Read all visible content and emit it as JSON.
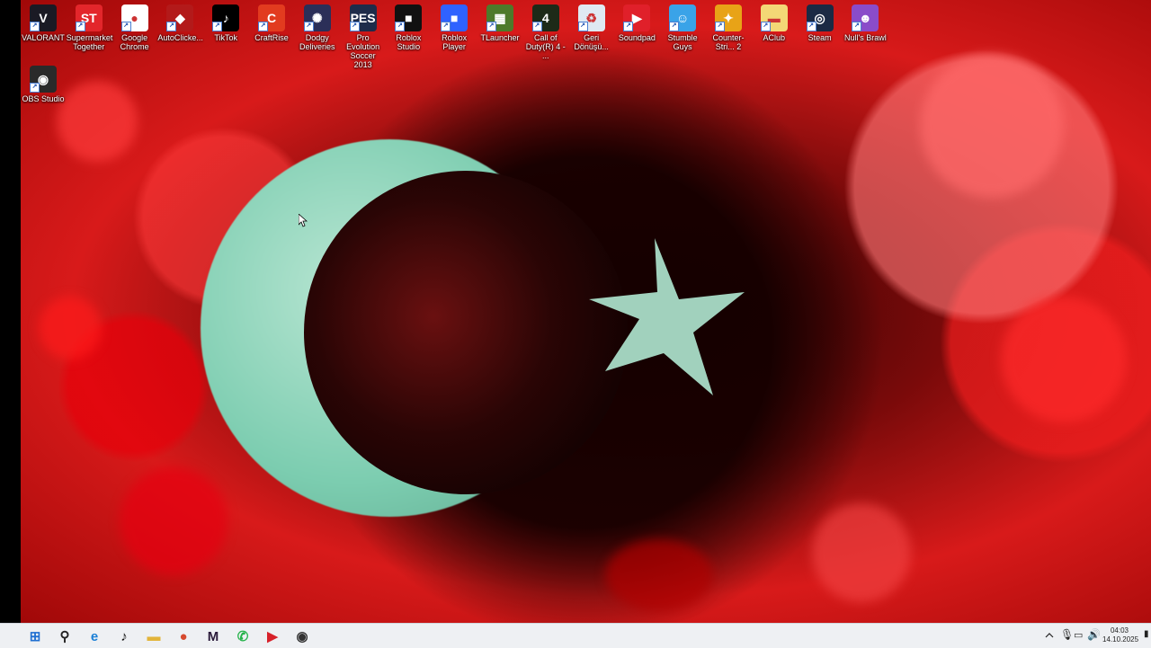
{
  "desktop": {
    "icons": [
      {
        "name": "valorant",
        "label": "VALORANT",
        "color": "#1a1a24",
        "glyph": "V"
      },
      {
        "name": "supermarket-together",
        "label": "Supermarket Together",
        "color": "#e3262b",
        "glyph": "ST"
      },
      {
        "name": "google-chrome",
        "label": "Google Chrome",
        "color": "#ffffff",
        "glyph": "●"
      },
      {
        "name": "autoclicker",
        "label": "AutoClicke...",
        "color": "#b31a1a",
        "glyph": "◆"
      },
      {
        "name": "tiktok",
        "label": "TikTok",
        "color": "#000000",
        "glyph": "♪"
      },
      {
        "name": "craftrise",
        "label": "CraftRise",
        "color": "#e23b1f",
        "glyph": "C"
      },
      {
        "name": "dodgy-deliveries",
        "label": "Dodgy Deliveries",
        "color": "#2b2f58",
        "glyph": "✺"
      },
      {
        "name": "pro-evolution-soccer",
        "label": "Pro Evolution Soccer 2013",
        "color": "#1e2c4a",
        "glyph": "PES"
      },
      {
        "name": "roblox-studio",
        "label": "Roblox Studio",
        "color": "#111111",
        "glyph": "■"
      },
      {
        "name": "roblox-player",
        "label": "Roblox Player",
        "color": "#2f62ff",
        "glyph": "■"
      },
      {
        "name": "tlauncher",
        "label": "TLauncher",
        "color": "#4d7a2a",
        "glyph": "▦"
      },
      {
        "name": "call-of-duty",
        "label": "Call of Duty(R) 4 - ...",
        "color": "#1d2a18",
        "glyph": "4"
      },
      {
        "name": "recycle-bin",
        "label": "Geri Dönüşü...",
        "color": "#dfe9f2",
        "glyph": "♻"
      },
      {
        "name": "soundpad",
        "label": "Soundpad",
        "color": "#e0202a",
        "glyph": "▶"
      },
      {
        "name": "stumble-guys",
        "label": "Stumble Guys",
        "color": "#3aa3e8",
        "glyph": "☺"
      },
      {
        "name": "counter-strike-2",
        "label": "Counter-Stri... 2",
        "color": "#e8a317",
        "glyph": "✦"
      },
      {
        "name": "aclub",
        "label": "AClub",
        "color": "#f3d776",
        "glyph": "▬"
      },
      {
        "name": "steam",
        "label": "Steam",
        "color": "#1b2a44",
        "glyph": "◎"
      },
      {
        "name": "nulls-brawl",
        "label": "Null's Brawl",
        "color": "#8a4cc9",
        "glyph": "☻"
      },
      {
        "name": "obs-studio",
        "label": "OBS Studio",
        "color": "#2a2a2a",
        "glyph": "◉"
      }
    ]
  },
  "taskbar": {
    "buttons": [
      {
        "name": "start-button",
        "glyph": "⊞"
      },
      {
        "name": "search-button",
        "glyph": "⚲"
      },
      {
        "name": "edge-button",
        "glyph": "e"
      },
      {
        "name": "tiktok-button",
        "glyph": "♪"
      },
      {
        "name": "file-explorer-button",
        "glyph": "▬"
      },
      {
        "name": "chrome-button",
        "glyph": "●"
      },
      {
        "name": "capcut-button",
        "glyph": "M"
      },
      {
        "name": "whatsapp-button",
        "glyph": "✆"
      },
      {
        "name": "soundpad-button",
        "glyph": "▶"
      },
      {
        "name": "obs-button",
        "glyph": "◉"
      }
    ],
    "clock_time": "04:03",
    "clock_date": "14.10.2025"
  }
}
